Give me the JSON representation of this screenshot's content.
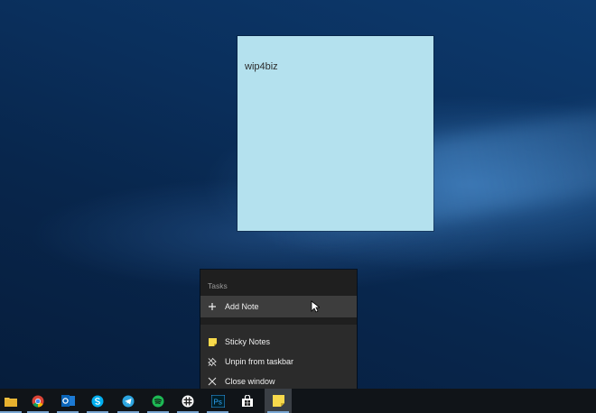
{
  "sticky_note": {
    "text": "wip4biz"
  },
  "jump_list": {
    "header": "Tasks",
    "tasks": [
      {
        "label": "Add Note",
        "icon": "plus-icon"
      }
    ],
    "actions": [
      {
        "label": "Sticky Notes",
        "icon": "sticky-notes-icon"
      },
      {
        "label": "Unpin from taskbar",
        "icon": "unpin-icon"
      },
      {
        "label": "Close window",
        "icon": "close-icon"
      }
    ]
  },
  "taskbar": {
    "apps": [
      {
        "name": "file-explorer",
        "color": "#f0c040"
      },
      {
        "name": "chrome",
        "color": "#db4437"
      },
      {
        "name": "outlook",
        "color": "#0a64b8"
      },
      {
        "name": "skype",
        "color": "#00aff0"
      },
      {
        "name": "telegram",
        "color": "#2ca5e0"
      },
      {
        "name": "spotify",
        "color": "#1db954"
      },
      {
        "name": "slack",
        "color": "#ffffff"
      },
      {
        "name": "photoshop",
        "color": "#31a8ff"
      },
      {
        "name": "store",
        "color": "#ffffff"
      },
      {
        "name": "sticky-notes",
        "color": "#f7d94c"
      }
    ]
  }
}
